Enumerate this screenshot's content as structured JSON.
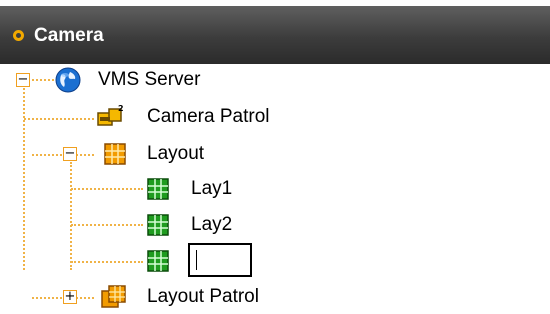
{
  "panel": {
    "title": "Camera"
  },
  "tree": {
    "root": {
      "label": "VMS Server",
      "icon": "globe-icon",
      "expanded": true
    },
    "camera_patrol": {
      "label": "Camera Patrol",
      "icon": "camera-patrol-icon"
    },
    "layout": {
      "label": "Layout",
      "icon": "layout-grid-icon",
      "expanded": true
    },
    "layout_children": [
      {
        "label": "Lay1",
        "icon": "layout-green-icon"
      },
      {
        "label": "Lay2",
        "icon": "layout-green-icon"
      }
    ],
    "new_layout": {
      "value": "",
      "icon": "layout-green-icon"
    },
    "layout_patrol": {
      "label": "Layout Patrol",
      "icon": "layout-patrol-icon",
      "expanded": false
    }
  },
  "colors": {
    "header_bg": "#3c3c3c",
    "accent": "#f2a900",
    "tree_line": "#f0b347",
    "layout_green": "#1f9c1f"
  }
}
